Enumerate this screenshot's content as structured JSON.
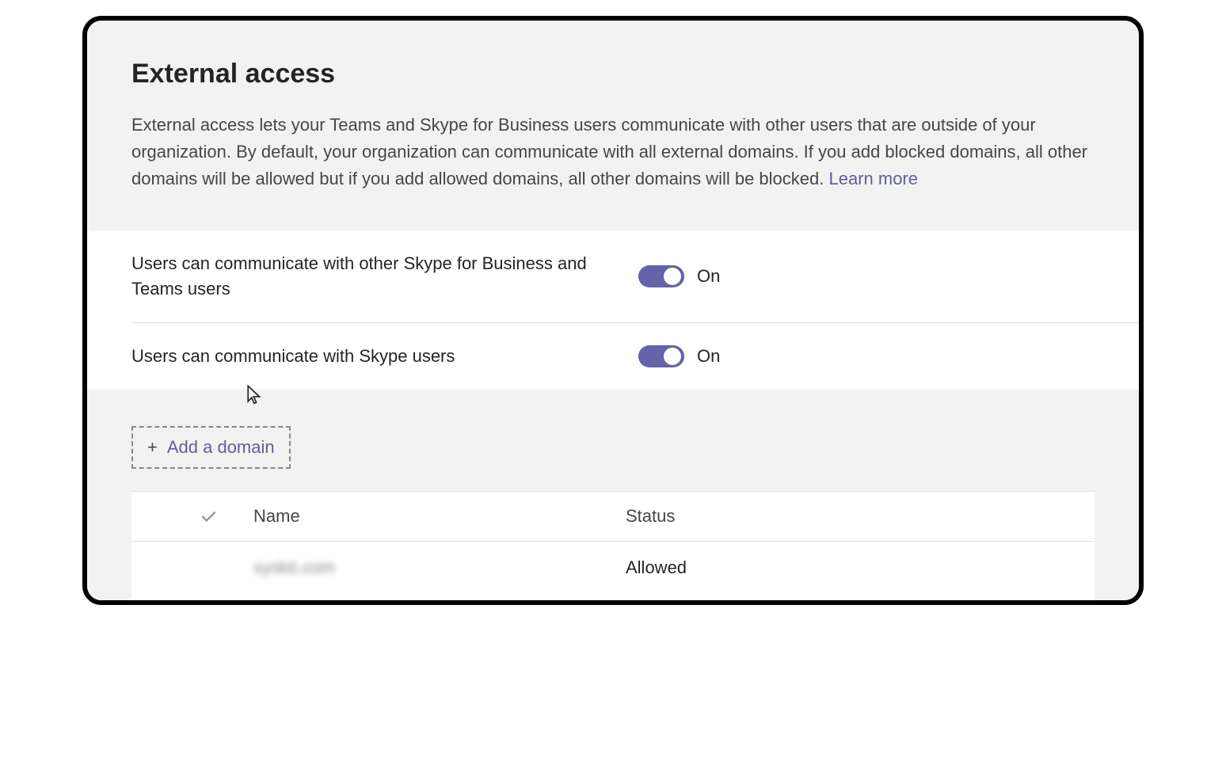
{
  "page": {
    "title": "External access",
    "description": "External access lets your Teams and Skype for Business users communicate with other users that are outside of your organization. By default, your organization can communicate with all external domains. If you add blocked domains, all other domains will be allowed but if you add allowed domains, all other domains will be blocked. ",
    "learn_more": "Learn more"
  },
  "toggles": [
    {
      "label": "Users can communicate with other Skype for Business and Teams users",
      "status": "On",
      "enabled": true
    },
    {
      "label": "Users can communicate with Skype users",
      "status": "On",
      "enabled": true
    }
  ],
  "add_domain_label": "Add a domain",
  "table": {
    "headers": {
      "name": "Name",
      "status": "Status"
    },
    "rows": [
      {
        "name": "syskit.com",
        "status": "Allowed"
      }
    ]
  }
}
